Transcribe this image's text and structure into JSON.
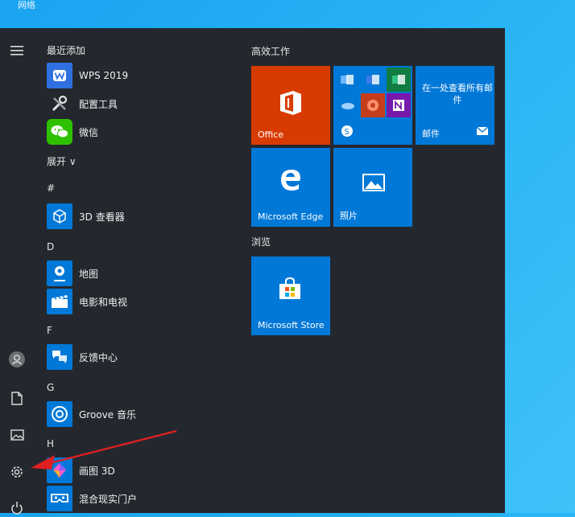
{
  "desktop": {
    "top_label": "网络"
  },
  "rail": {
    "items": [
      {
        "icon": "hamburger-menu-icon"
      },
      {
        "icon": "user-account-icon"
      },
      {
        "icon": "documents-icon"
      },
      {
        "icon": "pictures-icon"
      },
      {
        "icon": "settings-gear-icon"
      },
      {
        "icon": "power-icon"
      }
    ]
  },
  "app_list": {
    "recent_header": "最近添加",
    "expand_label": "展开 ∨",
    "sections": {
      "hash": "#",
      "d": "D",
      "f": "F",
      "g": "G",
      "h": "H"
    },
    "apps": {
      "wps": "WPS 2019",
      "config_tool": "配置工具",
      "wechat": "微信",
      "viewer3d": "3D 查看器",
      "maps": "地图",
      "movies": "电影和电视",
      "feedback": "反馈中心",
      "groove": "Groove 音乐",
      "paint3d": "画图 3D",
      "mixed_reality": "混合现实门户"
    }
  },
  "tiles": {
    "group_productivity": "高效工作",
    "group_browse": "浏览",
    "office": "Office",
    "mail_promo": "在一处查看所有邮件",
    "mail": "邮件",
    "edge": "Microsoft Edge",
    "photos": "照片",
    "store": "Microsoft Store"
  },
  "colors": {
    "accent": "#0078d7",
    "office_orange": "#d83b01",
    "menu_bg": "#24282e",
    "arrow_red": "#e02020"
  }
}
